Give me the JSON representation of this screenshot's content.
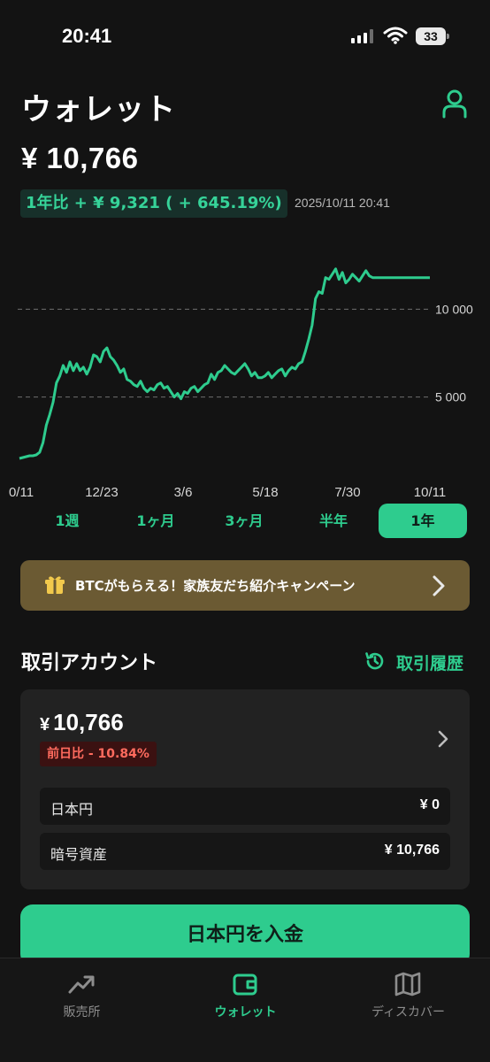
{
  "status_bar": {
    "time": "20:41",
    "battery": "33"
  },
  "header": {
    "title": "ウォレット"
  },
  "balance": {
    "amount": "¥ 10,766"
  },
  "change": {
    "text": "1年比 + ¥ 9,321 ( + 645.19%)",
    "timestamp": "2025/10/11 20:41"
  },
  "chart_data": {
    "type": "line",
    "x_tick_labels": [
      "0/11",
      "12/23",
      "3/6",
      "5/18",
      "7/30",
      "10/11"
    ],
    "y_tick_labels": [
      "10 000",
      "5 000"
    ],
    "y_ticks": [
      10000,
      5000
    ],
    "ylim": [
      1500,
      13500
    ],
    "grid": "dashed horizontal at y ticks",
    "color": "#2ecc8e",
    "x": [
      0,
      3,
      6,
      9,
      12,
      15,
      18,
      21,
      24,
      27,
      30,
      33,
      36,
      39,
      42,
      45,
      48,
      51,
      54,
      57,
      60,
      63,
      66,
      69,
      72,
      75,
      78,
      81,
      84,
      87,
      90,
      93,
      96,
      99,
      102,
      105,
      108,
      111,
      114,
      117,
      120,
      123,
      126,
      129,
      132,
      135,
      138,
      141,
      144,
      147,
      150,
      153,
      156,
      159,
      162,
      165,
      168,
      171,
      174,
      177,
      180,
      183,
      186,
      189,
      192,
      195,
      198,
      201,
      204,
      207,
      210,
      213,
      216,
      219,
      222,
      225,
      228,
      231,
      234,
      237,
      240,
      243,
      246,
      249,
      252,
      255,
      258,
      261,
      264,
      267,
      270,
      273,
      276,
      279,
      282,
      285,
      288,
      291,
      294,
      297,
      300,
      303,
      306,
      309,
      312,
      315,
      318,
      321,
      324,
      327,
      330,
      333,
      336,
      339,
      342,
      345,
      348,
      351,
      354,
      357,
      360,
      363,
      366
    ],
    "y": [
      1500,
      1550,
      1600,
      1650,
      1650,
      1700,
      1850,
      2400,
      3400,
      4000,
      4700,
      5800,
      6200,
      6800,
      6400,
      7000,
      6500,
      6900,
      6500,
      6700,
      6300,
      6700,
      7400,
      7300,
      7000,
      7600,
      7800,
      7300,
      7100,
      6800,
      6400,
      6600,
      6000,
      5900,
      5700,
      5600,
      5900,
      5500,
      5300,
      5500,
      5400,
      5700,
      5800,
      5500,
      5600,
      5300,
      5000,
      5200,
      4900,
      5300,
      5200,
      5500,
      5600,
      5300,
      5500,
      5700,
      5800,
      6300,
      6000,
      6400,
      6500,
      6800,
      6600,
      6400,
      6300,
      6500,
      6700,
      6900,
      6600,
      6200,
      6400,
      6100,
      6100,
      6200,
      6400,
      6100,
      6300,
      6500,
      6600,
      6200,
      6500,
      6700,
      6600,
      6900,
      7000,
      7600,
      8300,
      9100,
      10600,
      11000,
      10900,
      11800,
      11700,
      12000,
      12300,
      11700,
      12100,
      11500,
      11700,
      12000,
      11800,
      11600,
      11900,
      12200,
      11900,
      11800,
      11800,
      11800,
      11800,
      11800,
      11800,
      11800,
      11800,
      11800,
      11800,
      11800,
      11800,
      11800,
      11800,
      11800,
      11800,
      11800,
      11800
    ]
  },
  "ranges": {
    "items": [
      "1週",
      "1ヶ月",
      "3ヶ月",
      "半年",
      "1年"
    ],
    "active": "1年"
  },
  "banner": {
    "text": "BTCがもらえる！家族友だち紹介キャンペーン"
  },
  "section": {
    "title": "取引アカウント",
    "history_label": "取引履歴"
  },
  "account": {
    "yen_sign": "¥",
    "amount": "10,766",
    "change": "前日比 - 10.84%",
    "rows": [
      {
        "label": "日本円",
        "value": "¥ 0"
      },
      {
        "label": "暗号資産",
        "value": "¥ 10,766"
      }
    ]
  },
  "deposit_button": {
    "label": "日本円を入金"
  },
  "bottom_nav": {
    "items": [
      {
        "label": "販売所",
        "icon": "trend-icon"
      },
      {
        "label": "ウォレット",
        "icon": "wallet-icon"
      },
      {
        "label": "ディスカバー",
        "icon": "map-icon"
      }
    ],
    "active": "ウォレット"
  },
  "colors": {
    "accent": "#2ecc8e",
    "negative": "#ff6b5e",
    "background": "#131313",
    "banner": "#6b5a33"
  }
}
